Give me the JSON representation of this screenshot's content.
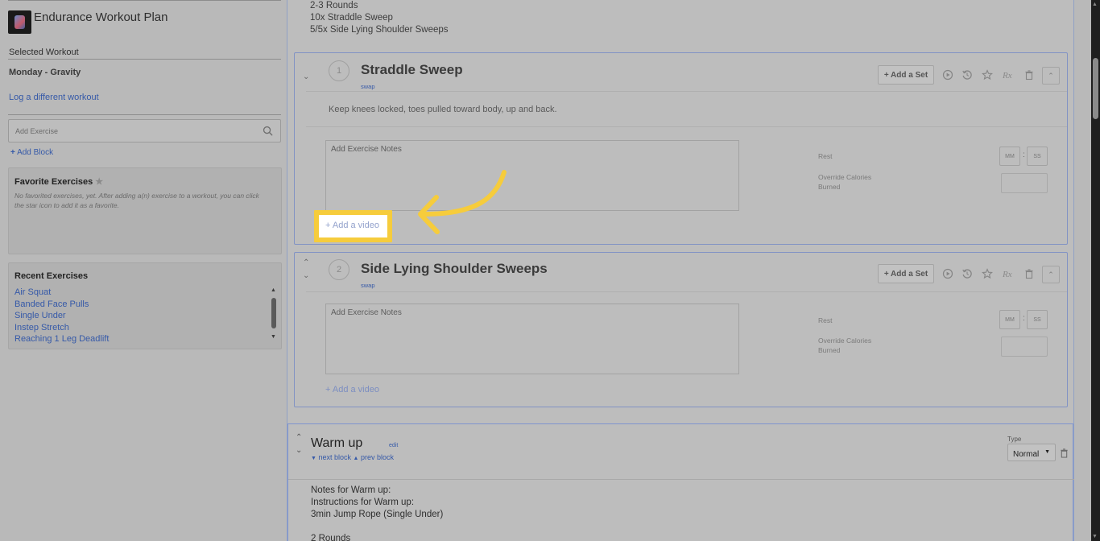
{
  "sidebar": {
    "plan_title": "Endurance Workout Plan",
    "selected_label": "Selected Workout",
    "selected_workout": "Monday - Gravity",
    "log_link": "Log a different workout",
    "add_exercise_placeholder": "Add Exercise",
    "add_block": "Add Block",
    "favorites": {
      "title": "Favorite Exercises",
      "empty_text": "No favorited exercises, yet. After adding a(n) exercise to a workout, you can click the star icon to add it as a favorite."
    },
    "recent": {
      "title": "Recent Exercises",
      "items": [
        "Air Squat",
        "Banded Face Pulls",
        "Single Under",
        "Instep Stretch",
        "Reaching 1 Leg Deadlift"
      ]
    }
  },
  "main": {
    "previous_block_lines": [
      "2-3 Rounds",
      "10x Straddle Sweep",
      "5/5x Side Lying Shoulder Sweeps"
    ],
    "exercises": [
      {
        "number": "1",
        "title": "Straddle Sweep",
        "swap": "swap",
        "description": "Keep knees locked, toes pulled toward body, up and back.",
        "notes_placeholder": "Add Exercise Notes",
        "rest_label": "Rest",
        "mm_placeholder": "MM",
        "ss_placeholder": "SS",
        "calories_label": "Override Calories Burned",
        "add_video": "+ Add a video",
        "add_set": "+ Add a Set"
      },
      {
        "number": "2",
        "title": "Side Lying Shoulder Sweeps",
        "swap": "swap",
        "notes_placeholder": "Add Exercise Notes",
        "rest_label": "Rest",
        "mm_placeholder": "MM",
        "ss_placeholder": "SS",
        "calories_label": "Override Calories Burned",
        "add_video": "+ Add a video",
        "add_set": "+ Add a Set"
      }
    ],
    "block": {
      "title": "Warm up",
      "edit": "edit",
      "next_block": "next block",
      "prev_block": "prev block",
      "type_label": "Type",
      "type_value": "Normal",
      "notes_lines": [
        "Notes for Warm up:",
        "Instructions for Warm up:",
        "3min Jump Rope (Single Under)",
        "",
        "2 Rounds"
      ]
    }
  },
  "highlight": {
    "label": "+ Add a video",
    "color": "#f6cc3c"
  },
  "colors": {
    "link": "#3559a8",
    "card_border": "#8293c4",
    "annotation": "#f6cc3c"
  }
}
